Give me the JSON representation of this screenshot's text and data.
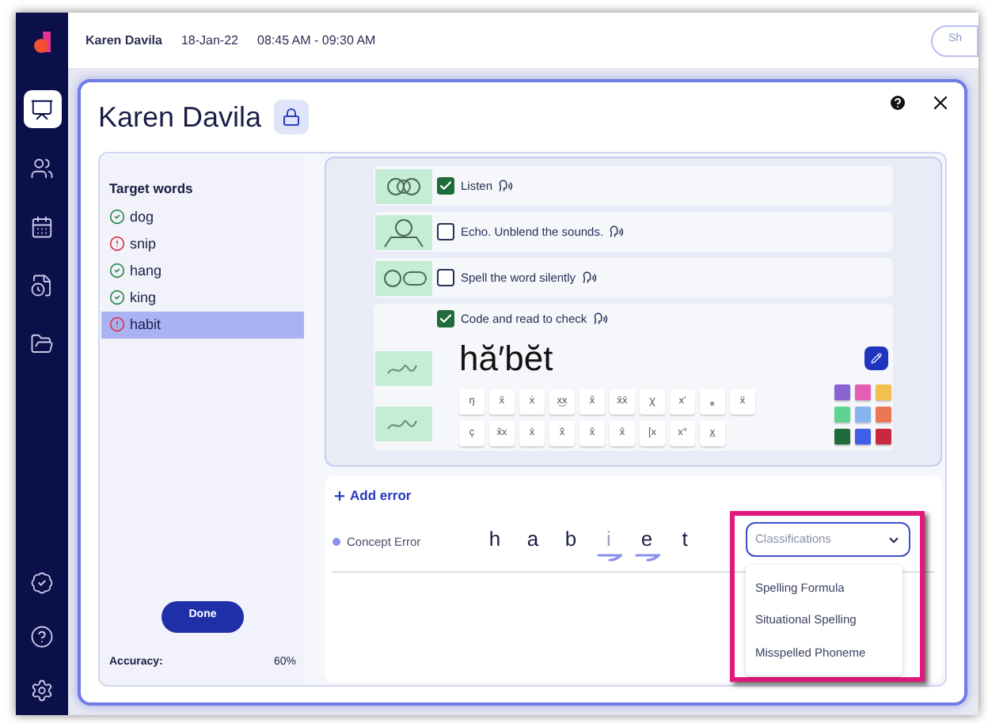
{
  "top_bar": {
    "student": "Karen Davila",
    "date": "18-Jan-22",
    "time": "08:45 AM - 09:30 AM",
    "button": "Sh"
  },
  "sidebar": {
    "items": [
      {
        "selected": true
      },
      {
        "selected": false
      },
      {
        "selected": false
      },
      {
        "selected": false
      },
      {
        "selected": false
      }
    ]
  },
  "modal": {
    "title": "Karen Davila",
    "locked": true
  },
  "target_words": {
    "title": "Target words",
    "items": [
      {
        "word": "dog",
        "kind": "correct",
        "selected": false
      },
      {
        "word": "snip",
        "kind": "error",
        "selected": false
      },
      {
        "word": "hang",
        "kind": "correct",
        "selected": false
      },
      {
        "word": "king",
        "kind": "correct",
        "selected": false
      },
      {
        "word": "habit",
        "kind": "error",
        "selected": true
      }
    ]
  },
  "done_button": "Done",
  "accuracy": {
    "label": "Accuracy:",
    "value": "60%"
  },
  "steps": [
    {
      "label": "Listen",
      "checked": true
    },
    {
      "label": "Echo. Unblend the sounds.",
      "checked": false
    },
    {
      "label": "Spell the word silently",
      "checked": false
    },
    {
      "label": "Code and read to check",
      "checked": true
    }
  ],
  "pronunciation": "hă′bĕt",
  "phonetic_keys": [
    [
      "ŋ",
      "x̆",
      "ẋ",
      "x͜x",
      "x̂",
      "x̄x̄",
      "ꭓ",
      "x′",
      "⁎",
      "ẍ"
    ],
    [
      "ç",
      "x̆x",
      "x̄",
      "x̃",
      "x̂",
      "x̂",
      "[x",
      "x°",
      "x̲"
    ]
  ],
  "swatches": [
    {
      "color": "#8a63d2"
    },
    {
      "color": "#e45fb4"
    },
    {
      "color": "#f2c14e"
    },
    {
      "color": "#5fd392"
    },
    {
      "color": "#86b4ee"
    },
    {
      "color": "#ea7656"
    },
    {
      "color": "#1f6b3c"
    },
    {
      "color": "#3f5fe6"
    },
    {
      "color": "#c9283e"
    }
  ],
  "errors": {
    "add_label": "Add error",
    "rows": [
      {
        "type": "Concept Error",
        "letters": [
          {
            "char": "h",
            "marked": false,
            "faded": false
          },
          {
            "char": "a",
            "marked": false,
            "faded": false
          },
          {
            "char": "b",
            "marked": false,
            "faded": false
          },
          {
            "char": "i",
            "marked": true,
            "faded": true
          },
          {
            "char": "e",
            "marked": true,
            "faded": false
          },
          {
            "char": "t",
            "marked": false,
            "faded": false
          }
        ]
      }
    ]
  },
  "classification": {
    "placeholder": "Classifications",
    "expanded": true,
    "options": [
      "Spelling Formula",
      "Situational Spelling",
      "Misspelled Phoneme"
    ]
  }
}
